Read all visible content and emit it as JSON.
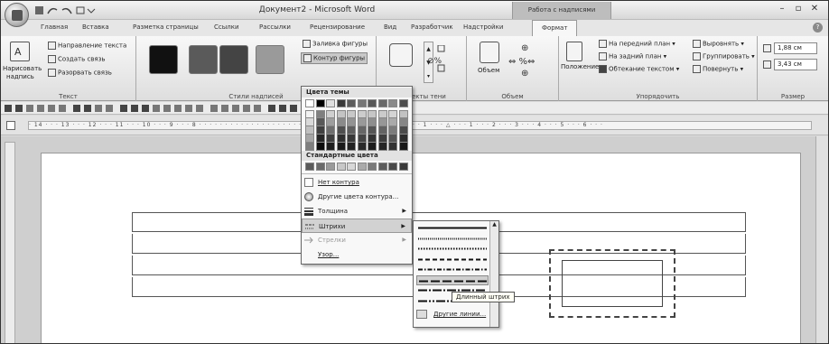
{
  "window": {
    "title": "Документ2 - Microsoft Word",
    "context_tab_title": "Работа с надписями",
    "controls": [
      "–",
      "▫",
      "✕"
    ]
  },
  "tabs": [
    {
      "label": "Главная"
    },
    {
      "label": "Вставка"
    },
    {
      "label": "Разметка страницы"
    },
    {
      "label": "Ссылки"
    },
    {
      "label": "Рассылки"
    },
    {
      "label": "Рецензирование"
    },
    {
      "label": "Вид"
    },
    {
      "label": "Разработчик"
    },
    {
      "label": "Надстройки"
    },
    {
      "label": "Формат",
      "active": true
    }
  ],
  "ribbon": {
    "text_group": {
      "label": "Текст",
      "draw_label_1": "Нарисовать",
      "draw_label_2": "надпись",
      "direction": "Направление текста",
      "create_link": "Создать связь",
      "break_link": "Разорвать связь"
    },
    "styles_group": {
      "label": "Стили надписей",
      "fill": "Заливка фигуры",
      "outline": "Контур фигуры",
      "swatches": [
        "#111111",
        "#5a5a5a",
        "#444444",
        "#9a9a9a"
      ]
    },
    "shadow_group": {
      "label": "Эффекты тени"
    },
    "volume_group": {
      "label": "Объем",
      "button": "Объем"
    },
    "arrange_group": {
      "label": "Упорядочить",
      "position": "Положение",
      "front": "На передний план",
      "back": "На задний план",
      "wrap": "Обтекание текстом",
      "align": "Выровнять",
      "group": "Группировать",
      "rotate": "Повернуть"
    },
    "size_group": {
      "label": "Размер",
      "height": "1,88 см",
      "width": "3,43 см"
    }
  },
  "ruler": {
    "ticks": "· 14 · · · 13 · · · 12 · · · 11 · · · 10 · · · 9 · · · 8 · · · · · · · · · · · · · · · · · · · · · · · · · · · · · · · · · · 3 · · · 2 · · · 1 · · · △ · · · 1 · · · 2 · · · 3 · · · 4 · · · 5 · · · 6 · · ·"
  },
  "outline_menu": {
    "theme_colors_header": "Цвета темы",
    "standard_colors_header": "Стандартные цвета",
    "theme_top_row": [
      "#ffffff",
      "#000000",
      "#e0e0e0",
      "#3a3a3a",
      "#5c5c5c",
      "#777777",
      "#585858",
      "#6a6a6a",
      "#8a8a8a",
      "#4e4e4e"
    ],
    "theme_shade_columns": [
      [
        "#f2f2f2",
        "#d9d9d9",
        "#bfbfbf",
        "#a6a6a6",
        "#7f7f7f"
      ],
      [
        "#7f7f7f",
        "#595959",
        "#404040",
        "#262626",
        "#0d0d0d"
      ],
      [
        "#cfcfcf",
        "#9e9e9e",
        "#6e6e6e",
        "#3e3e3e",
        "#1e1e1e"
      ],
      [
        "#c4c4c4",
        "#8a8a8a",
        "#4f4f4f",
        "#2f2f2f",
        "#1a1a1a"
      ],
      [
        "#c8c8c8",
        "#939393",
        "#5e5e5e",
        "#383838",
        "#222222"
      ],
      [
        "#cccccc",
        "#999999",
        "#666666",
        "#444444",
        "#2a2a2a"
      ],
      [
        "#c6c6c6",
        "#8e8e8e",
        "#555555",
        "#333333",
        "#1c1c1c"
      ],
      [
        "#cbcbcb",
        "#979797",
        "#636363",
        "#3d3d3d",
        "#252525"
      ],
      [
        "#d4d4d4",
        "#aaaaaa",
        "#7c7c7c",
        "#555555",
        "#333333"
      ],
      [
        "#c2c2c2",
        "#868686",
        "#4b4b4b",
        "#2c2c2c",
        "#181818"
      ]
    ],
    "standard_colors": [
      "#5a5a5a",
      "#6a6a6a",
      "#9a9a9a",
      "#c8c8c8",
      "#d8d8d8",
      "#aaaaaa",
      "#7a7a7a",
      "#5c5c5c",
      "#4a4a4a",
      "#3a3a3a"
    ],
    "no_outline": "Нет контура",
    "more_colors": "Другие цвета контура...",
    "weight": "Толщина",
    "dashes": "Штрихи",
    "arrows": "Стрелки",
    "pattern": "Узор..."
  },
  "dash_submenu": {
    "styles": [
      "solid",
      "round-dot",
      "square-dot",
      "dash",
      "dash-dot",
      "long-dash",
      "long-dash-dot",
      "long-dash-dot-dot"
    ],
    "selected_index": 5,
    "more_lines": "Другие линии...",
    "tooltip": "Длинный штрих"
  }
}
